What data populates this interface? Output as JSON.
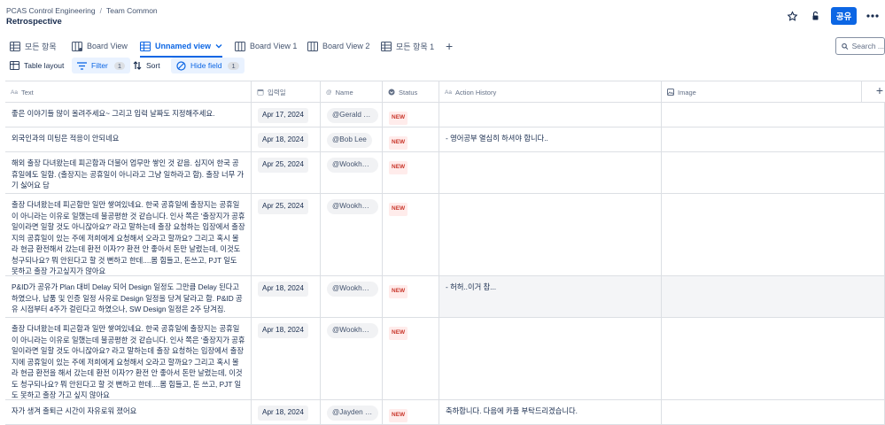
{
  "breadcrumb": {
    "space": "PCAS Control Engineering",
    "page": "Team Common"
  },
  "title": "Retrospective",
  "header": {
    "share_label": "공유"
  },
  "tabs": [
    {
      "label": "모든 항목",
      "icon": "table-icon"
    },
    {
      "label": "Board View",
      "icon": "board-icon"
    },
    {
      "label": "Unnamed view",
      "icon": "table-icon",
      "active": true,
      "dropdown": true
    },
    {
      "label": "Board View 1",
      "icon": "board-icon"
    },
    {
      "label": "Board View 2",
      "icon": "board-icon"
    },
    {
      "label": "모든 항목 1",
      "icon": "table-icon"
    }
  ],
  "search": {
    "placeholder": "Search ..."
  },
  "toolbar": {
    "layout": "Table layout",
    "filter": "Filter",
    "filter_count": "1",
    "sort": "Sort",
    "hide": "Hide field",
    "hide_count": "1"
  },
  "columns": [
    {
      "label": "Text",
      "icon": "Aa"
    },
    {
      "label": "입력일",
      "icon": "calendar"
    },
    {
      "label": "Name",
      "icon": "@"
    },
    {
      "label": "Status",
      "icon": "status"
    },
    {
      "label": "Action History",
      "icon": "Aa"
    },
    {
      "label": "Image",
      "icon": "image"
    }
  ],
  "rows": [
    {
      "text": "좋은 이야기들 많이 올려주세요~ 그리고 입력 날짜도 지정해주세요.",
      "date": "Apr 17, 2024",
      "name": "@Gerald Park",
      "status": "NEW",
      "action": ""
    },
    {
      "text": "외국인과의 미팅은 적응이 안되네요",
      "date": "Apr 18, 2024",
      "name": "@Bob Lee",
      "status": "NEW",
      "action": "- 영어공부 열심히 하셔야 합니다.."
    },
    {
      "text": "해외 출장 다녀왔는데 피곤함과 더불어 업무만 쌓인 것 같음. 심지어 한국 공휴일에도 일함. (출장지는 공휴일이 아니라고 그냥 일하라고 함). 출장 너무 가기 싫어요 담",
      "date": "Apr 25, 2024",
      "name": "@Wookhee ...",
      "status": "NEW",
      "action": ""
    },
    {
      "text": "출장 다녀왔는데 피곤함만 일만 쌓여있네요. 한국 공휴일에 출장지는 공휴일이 아니라는 이유로 일했는데 불공평한 것 같습니다. 인사 쪽은 '출장지가 공휴일이라면 일할 것도 아니잖아요?' 라고 말하는데 출장 요청하는 입장에서 출장지의 공휴일이 있는 주에 저희에게 요청해서 오라고 할까요? 그리고 혹시 몰라 현금 환전해서 갔는데 환전 이자?? 환전 안 좋아서 돈만 날렸는데, 이것도 청구되나요? 뭐 안된다고 할 것 뻔하고 한데....몸 힘들고, 돈쓰고, PJT 일도 못하고 출장 가고싶지가 않아요",
      "date": "Apr 25, 2024",
      "name": "@Wookhee ...",
      "status": "NEW",
      "action": ""
    },
    {
      "text": "P&ID가 공유가 Plan 대비 Delay 되어 Design 일정도 그만큼 Delay 된다고 하였으나, 납품 및 인증 일정 사유로 Design 일정을 당겨 달라고 함. P&ID 공유 시점부터 4주가 걸린다고 하였으나, SW Design 일정은 2주 당겨짐.",
      "date": "Apr 18, 2024",
      "name": "@Wookhee ...",
      "status": "NEW",
      "action": "- 허허..이거 참..."
    },
    {
      "text": "출장 다녀왔는데 피곤함과 일만 쌓여있네요. 한국 공휴일에 출장지는 공휴일이 아니라는 이유로 일했는데 불공평한 것 같습니다. 인사 쪽은 '출장지가 공휴일이라면 일할 것도 아니잖아요? 라고 말하는데 출장 요청하는 입장에서 출장지에 공휴일이 있는 주에 저희에게 요청해서 오라고 할까요? 그리고 혹시 몰라 현금 환전을 해서 갔는데 환전 이자?? 환전 안 좋아서 돈만 날렸는데, 이것도 청구되나요? 뭐 안된다고 할 것 뻔하고 한데....몸 힘들고, 돈 쓰고, PJT 일도 못하고 출장 가고 싶지 않아요",
      "date": "Apr 18, 2024",
      "name": "@Wookhee ...",
      "status": "NEW",
      "action": ""
    },
    {
      "text": "자가 생겨 출퇴근 시간이 자유로워 졌어요",
      "date": "Apr 18, 2024",
      "name": "@Jayden Kim",
      "status": "NEW",
      "action": "축하합니다. 다음에 카풀 부탁드리겠습니다."
    }
  ]
}
